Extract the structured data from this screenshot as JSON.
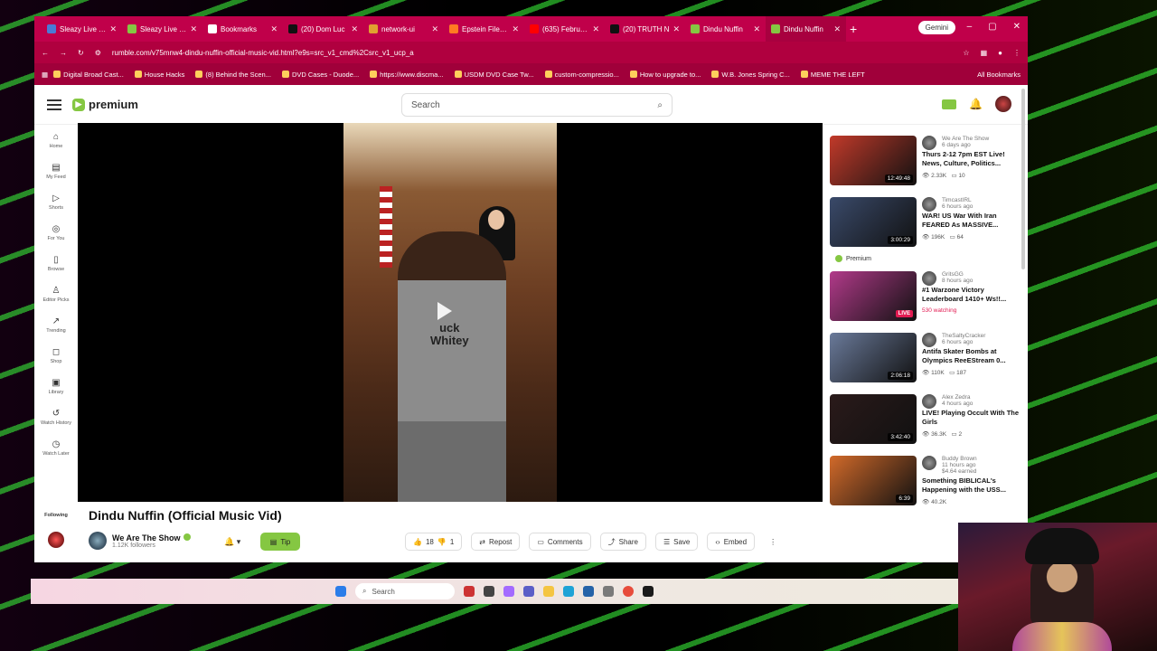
{
  "tabs": [
    {
      "title": "Sleazy Live fro",
      "color": "#4a7bd6"
    },
    {
      "title": "Sleazy Live Fro",
      "color": "#85c742"
    },
    {
      "title": "Bookmarks",
      "color": "#ffffff"
    },
    {
      "title": "(20) Dom Luc",
      "color": "#111111"
    },
    {
      "title": "network-ui",
      "color": "#e0a030"
    },
    {
      "title": "Epstein Files E",
      "color": "#ff7b22"
    },
    {
      "title": "(635) February",
      "color": "#ff0000"
    },
    {
      "title": "(20) TRUTH N",
      "color": "#111111"
    },
    {
      "title": "Dindu Nuffin",
      "color": "#85c742"
    },
    {
      "title": "Dindu Nuffin",
      "color": "#85c742"
    }
  ],
  "gemini_label": "Gemini",
  "url": "rumble.com/v75mnw4-dindu-nuffin-official-music-vid.html?e9s=src_v1_cmd%2Csrc_v1_ucp_a",
  "bookmarks": [
    "Digital Broad Cast...",
    "House Hacks",
    "(8) Behind the Scen...",
    "DVD Cases - Duode...",
    "https://www.discma...",
    "USDM DVD Case Tw...",
    "custom-compressio...",
    "How to upgrade to...",
    "W.B. Jones Spring C...",
    "MEME THE LEFT"
  ],
  "all_bookmarks": "All Bookmarks",
  "logo_text": "premium",
  "search_placeholder": "Search",
  "nav": [
    {
      "icon": "⌂",
      "label": "Home"
    },
    {
      "icon": "▤",
      "label": "My Feed"
    },
    {
      "icon": "▷",
      "label": "Shorts"
    },
    {
      "icon": "◎",
      "label": "For You"
    },
    {
      "icon": "▯",
      "label": "Browse"
    },
    {
      "icon": "♙",
      "label": "Editor Picks"
    },
    {
      "icon": "↗",
      "label": "Trending"
    },
    {
      "icon": "◻",
      "label": "Shop"
    },
    {
      "icon": "▣",
      "label": "Library"
    },
    {
      "icon": "↺",
      "label": "Watch History"
    },
    {
      "icon": "◷",
      "label": "Watch Later"
    }
  ],
  "following_label": "Following",
  "video": {
    "shirt_text": "uck\nWhitey",
    "title": "Dindu Nuffin (Official Music Vid)",
    "channel": "We Are The Show",
    "followers": "1.12K followers",
    "tip": "Tip",
    "likes": "18",
    "dislikes": "1",
    "actions": [
      "Repost",
      "Comments",
      "Share",
      "Save",
      "Embed"
    ]
  },
  "premium_label": "Premium",
  "sidebar": [
    {
      "channel": "We Are The Show",
      "ago": "6 days ago",
      "title": "Thurs 2-12 7pm EST Live! News, Culture, Politics...",
      "duration": "12:49:48",
      "views": "2.33K",
      "comments": "10",
      "color": "#c23a2a"
    },
    {
      "channel": "TimcastIRL",
      "ago": "6 hours ago",
      "title": "WAR! US War With Iran FEARED As MASSIVE...",
      "duration": "3:00:29",
      "views": "196K",
      "comments": "64",
      "color": "#3a4a6a"
    },
    {
      "channel": "GritsGG",
      "ago": "8 hours ago",
      "title": "#1 Warzone Victory Leaderboard 1410+ Ws!!...",
      "live": "LIVE",
      "watching": "530 watching",
      "color": "#b23a8a"
    },
    {
      "channel": "TheSaltyCracker",
      "ago": "6 hours ago",
      "title": "Antifa Skater Bombs at Olympics ReeEStream 0...",
      "duration": "2:06:18",
      "views": "110K",
      "comments": "187",
      "color": "#6a7a9a"
    },
    {
      "channel": "Alex Zedra",
      "ago": "4 hours ago",
      "title": "LIVE! Playing Occult With The Girls",
      "duration": "3:42:40",
      "views": "36.3K",
      "comments": "2",
      "color": "#2a1a1a"
    },
    {
      "channel": "Buddy Brown",
      "ago": "11 hours ago",
      "earned": "$4.64 earned",
      "title": "Something BIBLICAL's Happening with the USS...",
      "duration": "6:39",
      "views": "40.2K",
      "color": "#d26a2a"
    }
  ],
  "taskbar_search": "Search"
}
